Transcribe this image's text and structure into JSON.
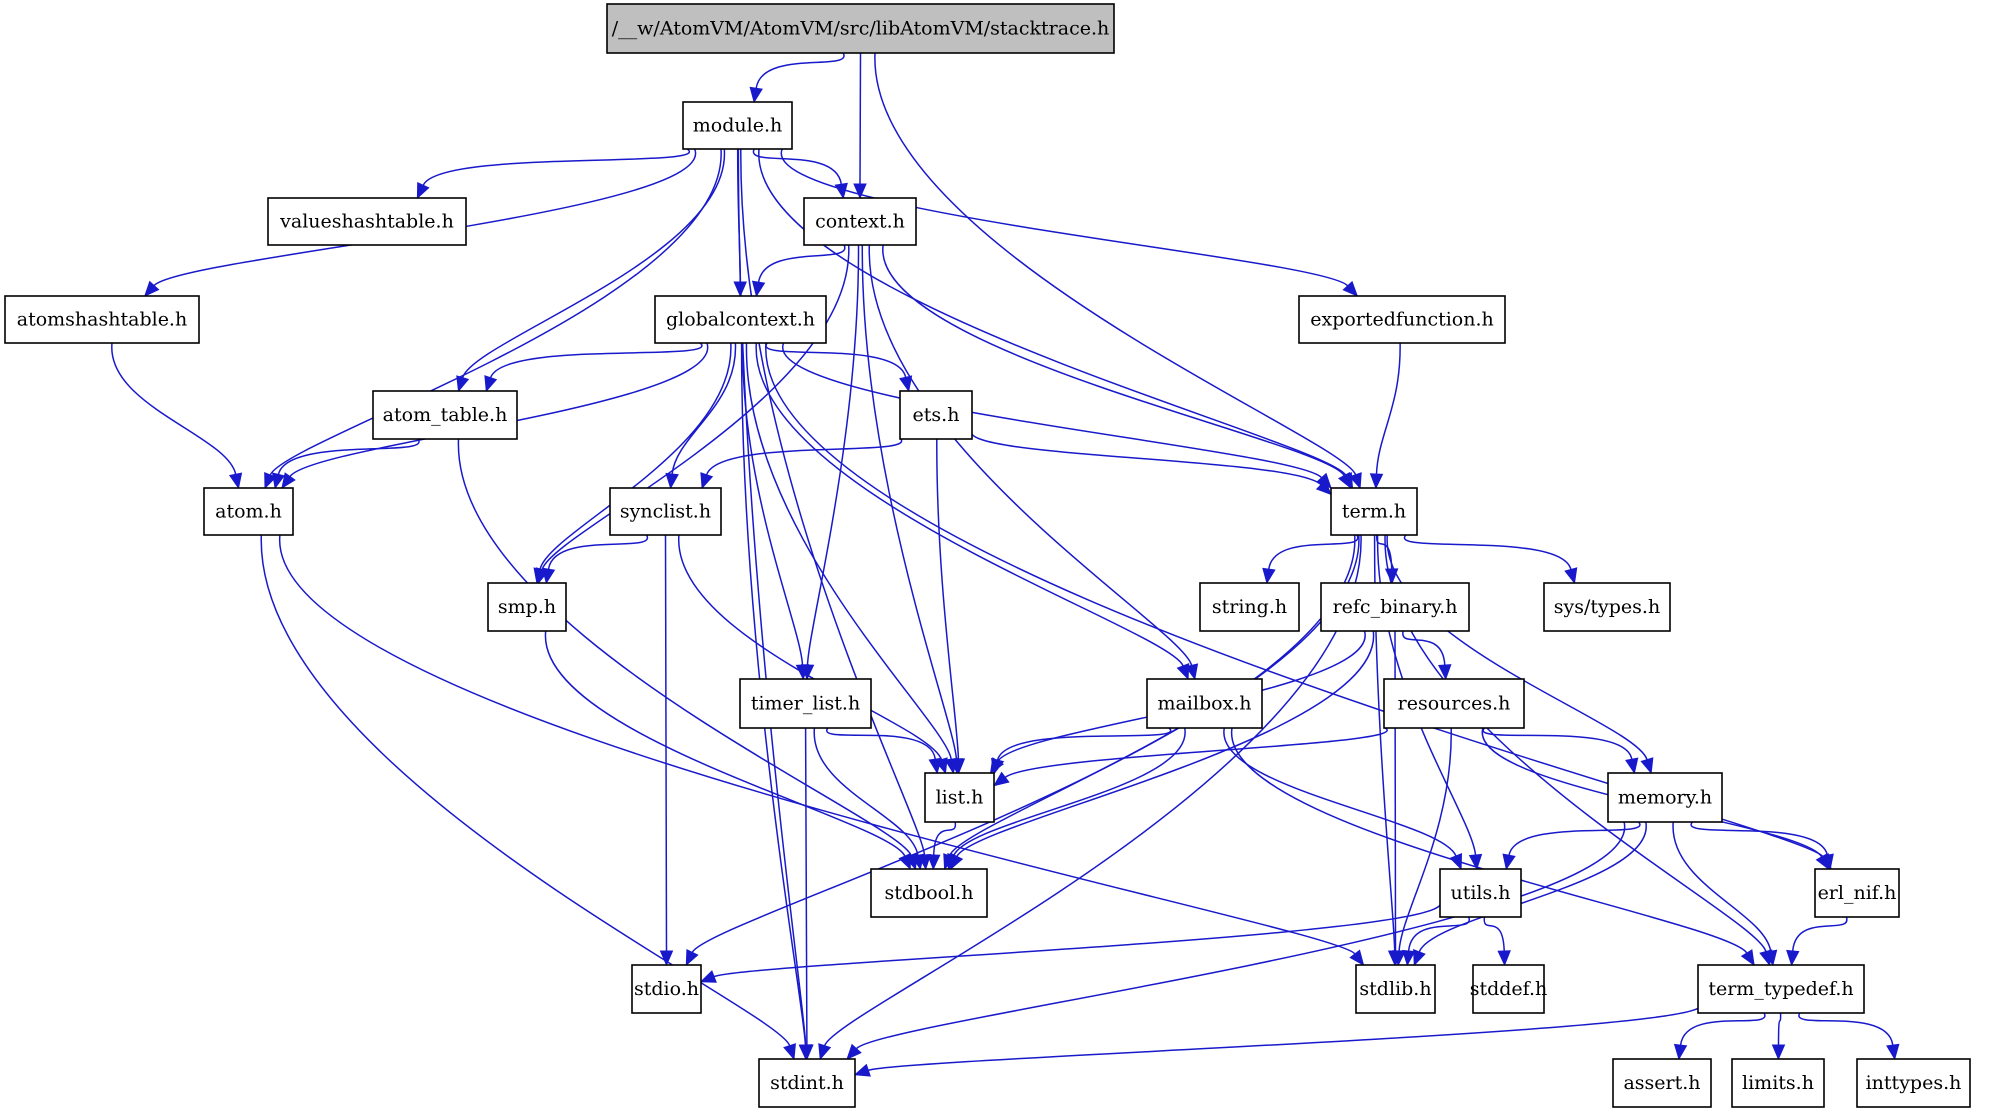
{
  "title": "/__w/AtomVM/AtomVM/src/libAtomVM/stacktrace.h",
  "colors": {
    "edge": "#1919cc",
    "root_fill": "#bfbfbf",
    "node_fill": "#ffffff",
    "node_border": "#000000"
  },
  "nodes": [
    {
      "id": "stacktrace",
      "label": "/__w/AtomVM/AtomVM/src/libAtomVM/stacktrace.h",
      "root": true
    },
    {
      "id": "module",
      "label": "module.h"
    },
    {
      "id": "context",
      "label": "context.h"
    },
    {
      "id": "valueshashtable",
      "label": "valueshashtable.h"
    },
    {
      "id": "atomshashtable",
      "label": "atomshashtable.h"
    },
    {
      "id": "globalcontext",
      "label": "globalcontext.h"
    },
    {
      "id": "exportedfunction",
      "label": "exportedfunction.h"
    },
    {
      "id": "atom_table",
      "label": "atom_table.h"
    },
    {
      "id": "ets",
      "label": "ets.h"
    },
    {
      "id": "atom",
      "label": "atom.h"
    },
    {
      "id": "synclist",
      "label": "synclist.h"
    },
    {
      "id": "term",
      "label": "term.h"
    },
    {
      "id": "smp",
      "label": "smp.h"
    },
    {
      "id": "string",
      "label": "string.h"
    },
    {
      "id": "refc_binary",
      "label": "refc_binary.h"
    },
    {
      "id": "systypes",
      "label": "sys/types.h"
    },
    {
      "id": "timer_list",
      "label": "timer_list.h"
    },
    {
      "id": "mailbox",
      "label": "mailbox.h"
    },
    {
      "id": "resources",
      "label": "resources.h"
    },
    {
      "id": "list",
      "label": "list.h"
    },
    {
      "id": "memory",
      "label": "memory.h"
    },
    {
      "id": "stdbool",
      "label": "stdbool.h"
    },
    {
      "id": "utils",
      "label": "utils.h"
    },
    {
      "id": "erl_nif",
      "label": "erl_nif.h"
    },
    {
      "id": "stdio",
      "label": "stdio.h"
    },
    {
      "id": "stdlib",
      "label": "stdlib.h"
    },
    {
      "id": "stddef",
      "label": "stddef.h"
    },
    {
      "id": "term_typedef",
      "label": "term_typedef.h"
    },
    {
      "id": "stdint",
      "label": "stdint.h"
    },
    {
      "id": "assert",
      "label": "assert.h"
    },
    {
      "id": "limits",
      "label": "limits.h"
    },
    {
      "id": "inttypes",
      "label": "inttypes.h"
    }
  ],
  "edges": [
    [
      "stacktrace",
      "module"
    ],
    [
      "stacktrace",
      "context"
    ],
    [
      "stacktrace",
      "term"
    ],
    [
      "module",
      "context"
    ],
    [
      "module",
      "valueshashtable"
    ],
    [
      "module",
      "atomshashtable"
    ],
    [
      "module",
      "globalcontext"
    ],
    [
      "module",
      "exportedfunction"
    ],
    [
      "module",
      "atom_table"
    ],
    [
      "module",
      "atom"
    ],
    [
      "module",
      "term"
    ],
    [
      "module",
      "stdbool"
    ],
    [
      "module",
      "stdint"
    ],
    [
      "context",
      "globalcontext"
    ],
    [
      "context",
      "smp"
    ],
    [
      "context",
      "term"
    ],
    [
      "context",
      "timer_list"
    ],
    [
      "context",
      "mailbox"
    ],
    [
      "context",
      "list"
    ],
    [
      "atomshashtable",
      "atom"
    ],
    [
      "globalcontext",
      "atom_table"
    ],
    [
      "globalcontext",
      "atom"
    ],
    [
      "globalcontext",
      "ets"
    ],
    [
      "globalcontext",
      "synclist"
    ],
    [
      "globalcontext",
      "smp"
    ],
    [
      "globalcontext",
      "term"
    ],
    [
      "globalcontext",
      "timer_list"
    ],
    [
      "globalcontext",
      "mailbox"
    ],
    [
      "globalcontext",
      "list"
    ],
    [
      "globalcontext",
      "erl_nif"
    ],
    [
      "globalcontext",
      "stdint"
    ],
    [
      "exportedfunction",
      "term"
    ],
    [
      "atom_table",
      "atom"
    ],
    [
      "atom_table",
      "stdbool"
    ],
    [
      "ets",
      "synclist"
    ],
    [
      "ets",
      "term"
    ],
    [
      "ets",
      "list"
    ],
    [
      "atom",
      "stdint"
    ],
    [
      "atom",
      "stdlib"
    ],
    [
      "synclist",
      "smp"
    ],
    [
      "synclist",
      "list"
    ],
    [
      "synclist",
      "stdio"
    ],
    [
      "term",
      "string"
    ],
    [
      "term",
      "refc_binary"
    ],
    [
      "term",
      "systypes"
    ],
    [
      "term",
      "utils"
    ],
    [
      "term",
      "memory"
    ],
    [
      "term",
      "stdbool"
    ],
    [
      "term",
      "stdio"
    ],
    [
      "term",
      "stdint"
    ],
    [
      "term",
      "stdlib"
    ],
    [
      "term",
      "term_typedef"
    ],
    [
      "smp",
      "stdbool"
    ],
    [
      "refc_binary",
      "resources"
    ],
    [
      "refc_binary",
      "list"
    ],
    [
      "refc_binary",
      "stdbool"
    ],
    [
      "refc_binary",
      "stdlib"
    ],
    [
      "timer_list",
      "list"
    ],
    [
      "timer_list",
      "stdbool"
    ],
    [
      "timer_list",
      "stdint"
    ],
    [
      "mailbox",
      "list"
    ],
    [
      "mailbox",
      "utils"
    ],
    [
      "mailbox",
      "stdbool"
    ],
    [
      "mailbox",
      "term_typedef"
    ],
    [
      "resources",
      "list"
    ],
    [
      "resources",
      "memory"
    ],
    [
      "resources",
      "erl_nif"
    ],
    [
      "resources",
      "stdlib"
    ],
    [
      "list",
      "stdbool"
    ],
    [
      "memory",
      "utils"
    ],
    [
      "memory",
      "erl_nif"
    ],
    [
      "memory",
      "term_typedef"
    ],
    [
      "memory",
      "stdlib"
    ],
    [
      "memory",
      "stdint"
    ],
    [
      "utils",
      "stdlib"
    ],
    [
      "utils",
      "stddef"
    ],
    [
      "utils",
      "stdio"
    ],
    [
      "erl_nif",
      "term_typedef"
    ],
    [
      "term_typedef",
      "assert"
    ],
    [
      "term_typedef",
      "limits"
    ],
    [
      "term_typedef",
      "inttypes"
    ],
    [
      "term_typedef",
      "stdint"
    ]
  ]
}
